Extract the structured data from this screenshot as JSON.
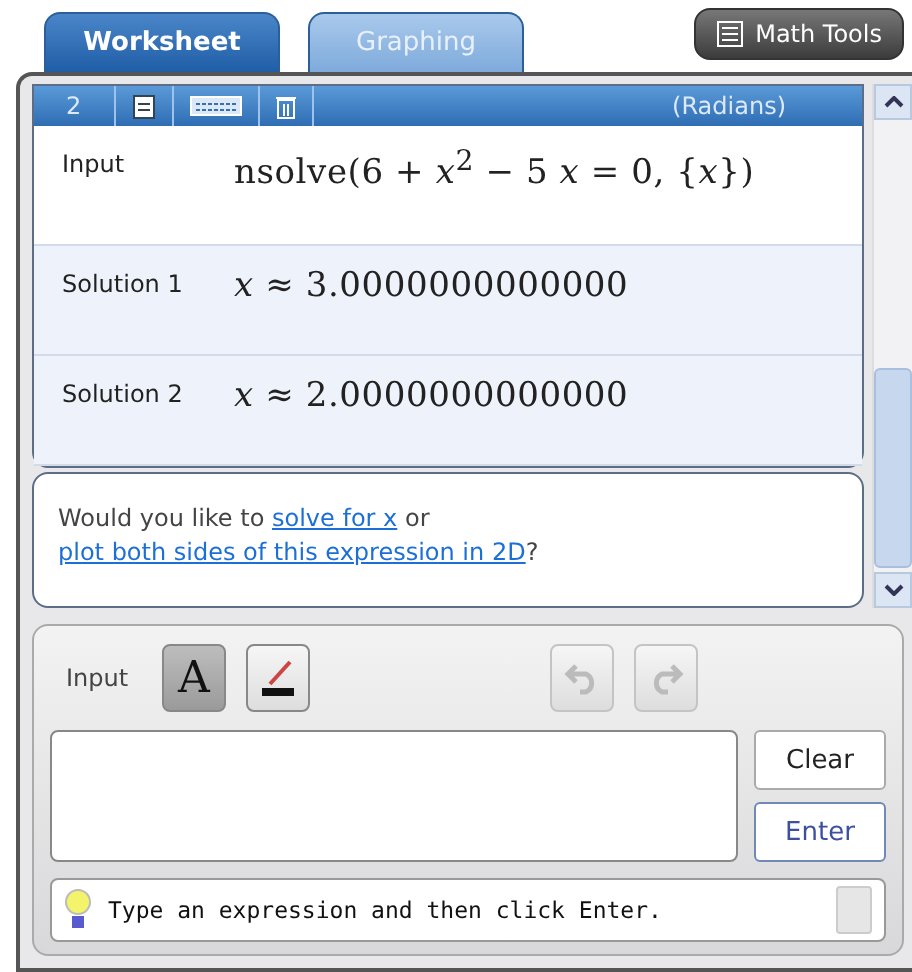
{
  "tabs": [
    {
      "label": "Worksheet",
      "selected": true
    },
    {
      "label": "Graphing",
      "selected": false
    }
  ],
  "math_tools_button": "Math Tools",
  "worksheet": {
    "header": {
      "number": "2",
      "mode": "(Radians)"
    },
    "rows": [
      {
        "label": "Input",
        "expression": "nsolve(6 + *x*$^{2}$ − 5 *x* = 0, {*x*})"
      },
      {
        "label": "Solution 1",
        "expression": "*x* ≈ 3.0000000000000"
      },
      {
        "label": "Solution 2",
        "expression": "*x* ≈ 2.0000000000000"
      }
    ],
    "suggestion": [
      {
        "kind": "text",
        "text": "Would you like to "
      },
      {
        "kind": "link",
        "text": "solve for x"
      },
      {
        "kind": "text",
        "text": " or "
      },
      {
        "kind": "link",
        "text": "plot both sides of this expression in 2D"
      },
      {
        "kind": "text",
        "text": "?"
      }
    ]
  },
  "input_panel": {
    "label": "Input",
    "modes": [
      {
        "kind": "text",
        "label": "A",
        "selected": true
      },
      {
        "kind": "draw",
        "selected": false
      }
    ],
    "history": [
      {
        "kind": "undo",
        "disabled": true
      },
      {
        "kind": "redo",
        "disabled": true
      }
    ],
    "buttons": [
      {
        "label": "Clear",
        "primary": false
      },
      {
        "label": "Enter",
        "primary": true
      }
    ],
    "hint": "Type an expression and then click Enter."
  }
}
